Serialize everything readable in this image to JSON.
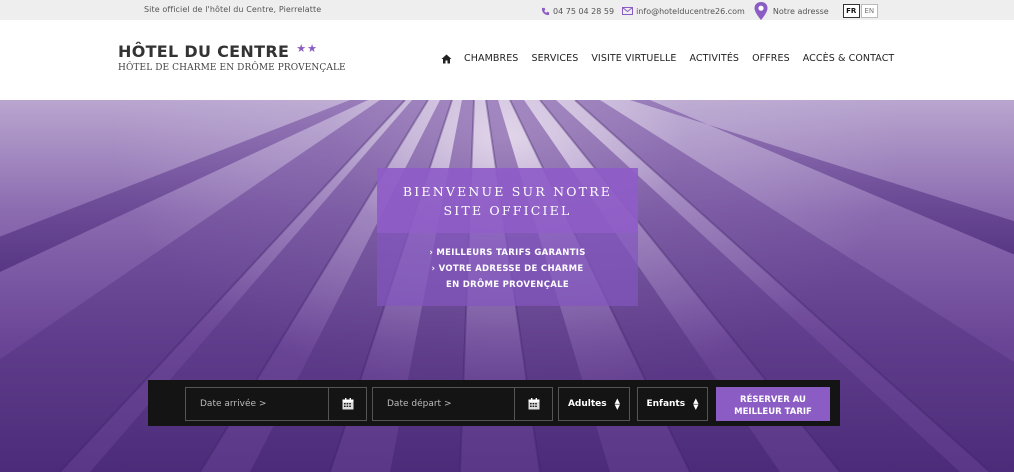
{
  "topbar": {
    "tagline": "Site officiel de l'hôtel du Centre, Pierrelatte",
    "phone": "04 75 04 28 59",
    "email": "info@hotelducentre26.com",
    "address_label": "Notre adresse",
    "languages": [
      "FR",
      "EN"
    ],
    "active_language": "FR"
  },
  "header": {
    "hotel_name": "HÔTEL DU CENTRE",
    "stars": "★★",
    "subtitle": "HÔTEL DE CHARME EN DRÔME PROVENÇALE"
  },
  "nav": {
    "items": [
      "CHAMBRES",
      "SERVICES",
      "VISITE VIRTUELLE",
      "ACTIVITÉS",
      "OFFRES",
      "ACCÈS & CONTACT"
    ]
  },
  "hero": {
    "welcome_line1": "BIENVENUE SUR NOTRE",
    "welcome_line2": "SITE OFFICIEL",
    "bullet1": "› MEILLEURS TARIFS GARANTIS",
    "bullet2": "› VOTRE ADRESSE DE CHARME",
    "bullet3": "EN DRÔME PROVENÇALE"
  },
  "booking": {
    "arrival_placeholder": "Date arrivée >",
    "departure_placeholder": "Date départ >",
    "adults_label": "Adultes",
    "children_label": "Enfants",
    "book_line1": "RÉSERVER AU",
    "book_line2": "MEILLEUR TARIF"
  },
  "colors": {
    "accent": "#8a5cc4",
    "booking_bg": "#141414",
    "topbar_bg": "#eeeeee"
  }
}
